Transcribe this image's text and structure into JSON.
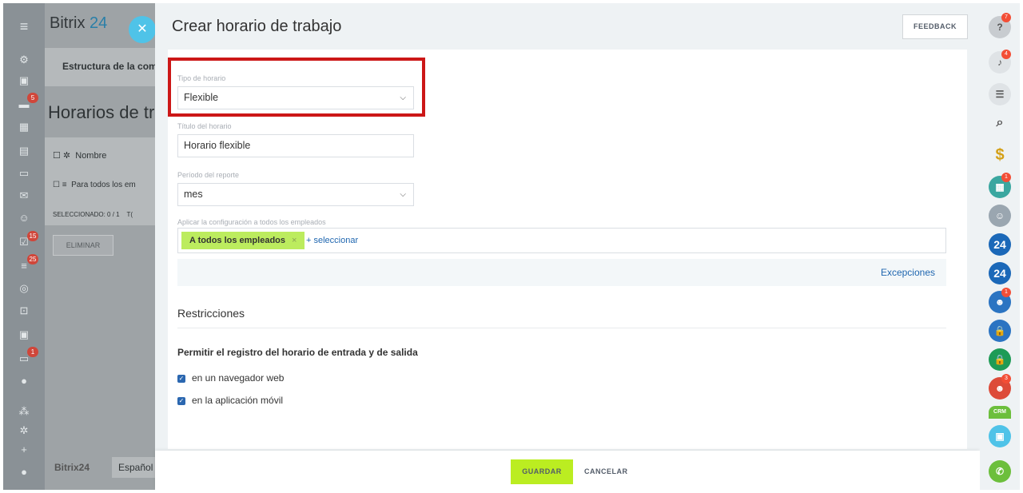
{
  "background": {
    "logo_text": "Bitrix",
    "logo_num": "24",
    "card_text": "Estructura de la com",
    "page_title": "Horarios de tra",
    "table_header": "Nombre",
    "table_row": "Para todos los em",
    "selected_label": "SELECCIONADO: 0 / 1",
    "selected_extra": "T(",
    "delete_label": "ELIMINAR",
    "footer_logo": "Bitrix24",
    "footer_lang": "Español"
  },
  "left_sidebar": {
    "badges": [
      "5",
      "15",
      "25",
      "1"
    ]
  },
  "slider": {
    "title": "Crear horario de trabajo",
    "feedback_label": "FEEDBACK",
    "close_icon": "close-icon"
  },
  "form": {
    "schedule_type": {
      "label": "Tipo de horario",
      "value": "Flexible"
    },
    "schedule_title": {
      "label": "Título del horario",
      "value": "Horario flexible"
    },
    "report_period": {
      "label": "Período del reporte",
      "value": "mes"
    },
    "employees": {
      "label": "Aplicar la configuración a todos los empleados",
      "tag": "A todos los empleados",
      "tag_remove": "×",
      "add_link": "+ seleccionar"
    },
    "exceptions_label": "Excepciones",
    "restrictions_title": "Restricciones",
    "permit_title": "Permitir el registro del horario de entrada y de salida",
    "checkboxes": [
      {
        "label": "en un navegador web",
        "checked": true
      },
      {
        "label": "en la aplicación móvil",
        "checked": true
      }
    ]
  },
  "actions": {
    "save_label": "GUARDAR",
    "cancel_label": "CANCELAR"
  },
  "right_bar": {
    "badges": {
      "help": "7",
      "notifications": "4",
      "calendar": "1",
      "group": "1",
      "users": "3"
    },
    "labels": {
      "b24a": "24",
      "b24b": "24",
      "crm": "CRM"
    }
  },
  "colors": {
    "highlight": "#cc1717",
    "save": "#bbed21",
    "link": "#2067b0",
    "tag": "#bcec5e"
  }
}
